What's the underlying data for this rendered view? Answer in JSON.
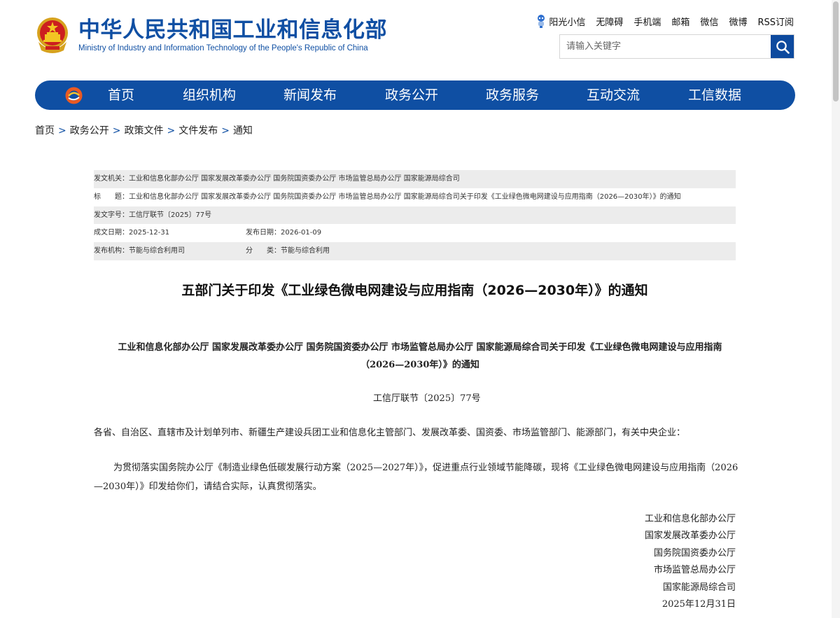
{
  "header": {
    "title_cn": "中华人民共和国工业和信息化部",
    "title_en": "Ministry of Industry and Information Technology of the People's Republic of China",
    "top_links": [
      "阳光小信",
      "无障碍",
      "手机端",
      "邮箱",
      "微信",
      "微博",
      "RSS订阅"
    ],
    "search_placeholder": "请输入关键字"
  },
  "nav": {
    "items": [
      "首页",
      "组织机构",
      "新闻发布",
      "政务公开",
      "政务服务",
      "互动交流",
      "工信数据"
    ]
  },
  "breadcrumb": [
    "首页",
    "政务公开",
    "政策文件",
    "文件发布",
    "通知"
  ],
  "meta": {
    "issuer_label": "发文机关：",
    "issuer": "工业和信息化部办公厅 国家发展改革委办公厅 国务院国资委办公厅 市场监管总局办公厅 国家能源局综合司",
    "title_label": "标　　题：",
    "title": "工业和信息化部办公厅 国家发展改革委办公厅 国务院国资委办公厅 市场监管总局办公厅 国家能源局综合司关于印发《工业绿色微电网建设与应用指南（2026—2030年）》的通知",
    "docno_label": "发文字号：",
    "docno": "工信厅联节〔2025〕77号",
    "created_label": "成文日期：",
    "created": "2025-12-31",
    "published_label": "发布日期：",
    "published": "2026-01-09",
    "org_label": "发布机构：",
    "org": "节能与综合利用司",
    "category_label": "分　　类：",
    "category": "节能与综合利用"
  },
  "article": {
    "title": "五部门关于印发《工业绿色微电网建设与应用指南（2026—2030年）》的通知",
    "subtitle": "工业和信息化部办公厅 国家发展改革委办公厅 国务院国资委办公厅 市场监管总局办公厅 国家能源局综合司关于印发《工业绿色微电网建设与应用指南（2026—2030年）》的通知",
    "docno": "工信厅联节〔2025〕77号",
    "addressee": "各省、自治区、直辖市及计划单列市、新疆生产建设兵团工业和信息化主管部门、发展改革委、国资委、市场监管部门、能源部门，有关中央企业：",
    "body": "为贯彻落实国务院办公厅《制造业绿色低碳发展行动方案（2025—2027年）》，促进重点行业领域节能降碳，现将《工业绿色微电网建设与应用指南（2026—2030年）》印发给你们，请结合实际，认真贯彻落实。",
    "signatures": [
      "工业和信息化部办公厅",
      "国家发展改革委办公厅",
      "国务院国资委办公厅",
      "市场监管总局办公厅",
      "国家能源局综合司",
      "2025年12月31日"
    ]
  },
  "colors": {
    "brand_blue": "#0f4fa3",
    "meta_row_gray": "#ececec"
  },
  "icons": {
    "emblem": "national-emblem-icon",
    "robot": "robot-icon",
    "search": "search-icon",
    "nav_logo": "miit-logo-icon"
  }
}
